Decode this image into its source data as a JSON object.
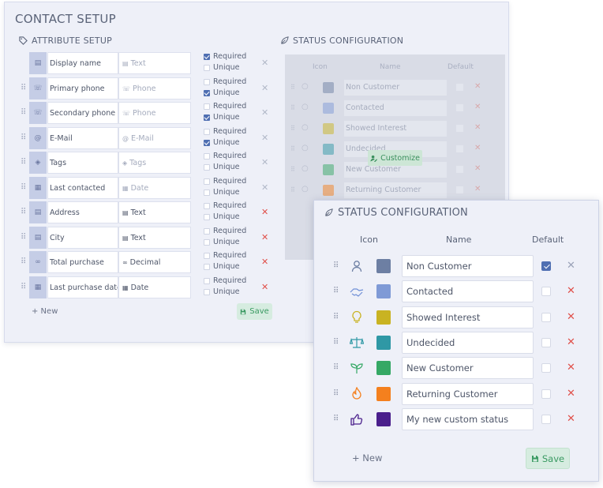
{
  "contact_setup": {
    "title": "CONTACT SETUP",
    "attribute_setup_title": "ATTRIBUTE SETUP",
    "status_config_title": "STATUS CONFIGURATION",
    "attributes": [
      {
        "name": "Display name",
        "type": "Text",
        "type_muted": true,
        "required": true,
        "unique": false,
        "required_label": "Required",
        "unique_label": "Unique",
        "icon": "text-icon",
        "removable": false
      },
      {
        "name": "Primary phone",
        "type": "Phone",
        "type_muted": true,
        "required": false,
        "unique": true,
        "required_label": "Required",
        "unique_label": "Unique",
        "icon": "phone-icon",
        "removable": false
      },
      {
        "name": "Secondary phone",
        "type": "Phone",
        "type_muted": true,
        "required": false,
        "unique": true,
        "required_label": "Required",
        "unique_label": "Unique",
        "icon": "phone-icon",
        "removable": false
      },
      {
        "name": "E-Mail",
        "type": "E-Mail",
        "type_muted": true,
        "required": false,
        "unique": true,
        "required_label": "Required",
        "unique_label": "Unique",
        "icon": "email-icon",
        "removable": false
      },
      {
        "name": "Tags",
        "type": "Tags",
        "type_muted": true,
        "required": false,
        "unique": false,
        "required_label": "Required",
        "unique_label": "Unique",
        "icon": "tag-icon",
        "removable": false
      },
      {
        "name": "Last contacted",
        "type": "Date",
        "type_muted": true,
        "required": false,
        "unique": false,
        "required_label": "Required",
        "unique_label": "Unique",
        "icon": "calendar-icon",
        "removable": false
      },
      {
        "name": "Address",
        "type": "Text",
        "type_muted": false,
        "required": false,
        "unique": false,
        "required_label": "Required",
        "unique_label": "Unique",
        "icon": "text-icon",
        "removable": true
      },
      {
        "name": "City",
        "type": "Text",
        "type_muted": false,
        "required": false,
        "unique": false,
        "required_label": "Required",
        "unique_label": "Unique",
        "icon": "text-icon",
        "removable": true
      },
      {
        "name": "Total purchase",
        "type": "Decimal",
        "type_muted": false,
        "required": false,
        "unique": false,
        "required_label": "Required",
        "unique_label": "Unique",
        "icon": "decimal-icon",
        "removable": true
      },
      {
        "name": "Last purchase date",
        "type": "Date",
        "type_muted": false,
        "required": false,
        "unique": false,
        "required_label": "Required",
        "unique_label": "Unique",
        "icon": "calendar-icon",
        "removable": true
      }
    ],
    "new_label": "+ New",
    "save_label": "Save",
    "bg_status": {
      "col_icon": "Icon",
      "col_name": "Name",
      "col_default": "Default",
      "customize_label": "Customize",
      "rows": [
        "Non Customer",
        "Contacted",
        "Showed Interest",
        "Undecided",
        "New Customer",
        "Returning Customer"
      ]
    }
  },
  "status_config": {
    "title": "STATUS CONFIGURATION",
    "col_icon": "Icon",
    "col_name": "Name",
    "col_default": "Default",
    "statuses": [
      {
        "name": "Non Customer",
        "color": "#6d7fa3",
        "icon": "person-icon",
        "icon_color": "#6d7fa3",
        "default": true
      },
      {
        "name": "Contacted",
        "color": "#7f9ad6",
        "icon": "handshake-icon",
        "icon_color": "#6f8fd6",
        "default": false
      },
      {
        "name": "Showed Interest",
        "color": "#c9b322",
        "icon": "lightbulb-icon",
        "icon_color": "#c9b322",
        "default": false
      },
      {
        "name": "Undecided",
        "color": "#2f98a5",
        "icon": "scale-icon",
        "icon_color": "#2f98a5",
        "default": false
      },
      {
        "name": "New Customer",
        "color": "#35a865",
        "icon": "sprout-icon",
        "icon_color": "#35a865",
        "default": false
      },
      {
        "name": "Returning Customer",
        "color": "#f4801e",
        "icon": "flame-icon",
        "icon_color": "#f4801e",
        "default": false
      },
      {
        "name": "My new custom status",
        "color": "#4a1f8c",
        "icon": "thumbs-up-icon",
        "icon_color": "#4a1f8c",
        "default": false
      }
    ],
    "new_label": "+ New",
    "save_label": "Save"
  }
}
